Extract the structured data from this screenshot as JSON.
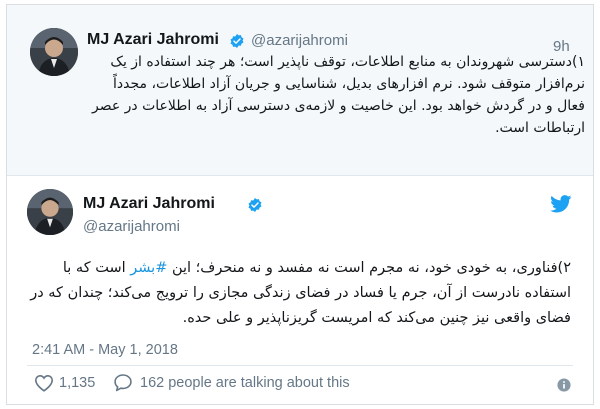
{
  "parent_tweet": {
    "author_name": "MJ Azari Jahromi",
    "handle": "@azarijahromi",
    "time": "9h",
    "text": "۱)دسترسی شهروندان به منابع اطلاعات، توقف ناپذیر است؛ هر چند استفاده از یک نرم‌افزار متوقف شود. نرم افزارهای بدیل، شناسایی و جریان آزاد اطلاعات، مجدداً فعال و در گردش خواهد بود. این خاصیت و لازمه‌ی دسترسی آزاد به اطلاعات در عصر ارتباطات است.",
    "verified_icon": "verified-badge-icon",
    "avatar_icon": "profile-photo"
  },
  "main_tweet": {
    "author_name": "MJ Azari Jahromi",
    "handle": "@azarijahromi",
    "text_before": "۲)فناوری، به خودی خود، نه مجرم است نه مفسد و نه منحرف؛ این ",
    "hashtag": "#بشر",
    "text_after": " است که با استفاده نادرست از آن، جرم یا فساد در فضای زندگی مجازی را ترویج می‌کند؛ چندان که در فضای واقعی نیز چنین می‌کند که امریست گریزناپذیر و علی حده.",
    "date": "2:41 AM - May 1, 2018",
    "like_count": "1,135",
    "talking_text": "162 people are talking about this",
    "icons": {
      "logo": "twitter-bird-icon",
      "like": "heart-icon",
      "reply": "speech-bubble-icon",
      "info": "info-icon"
    }
  },
  "colors": {
    "link_blue": "#1b95e0",
    "verified_blue": "#1da1f2",
    "secondary_text": "#657786",
    "parent_background": "#f5f8fa"
  }
}
